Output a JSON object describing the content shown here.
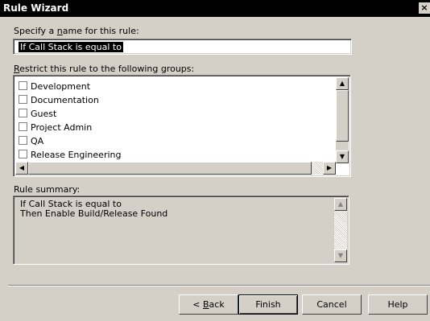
{
  "window": {
    "title": "Rule Wizard",
    "close_glyph": "×"
  },
  "name_section": {
    "label_pre": "Specify a ",
    "label_key": "n",
    "label_post": "ame for this rule:",
    "value": "If Call Stack is equal to"
  },
  "groups_section": {
    "label_key": "R",
    "label_post": "estrict this rule to the following groups:",
    "items": [
      {
        "label": "Development",
        "checked": false
      },
      {
        "label": "Documentation",
        "checked": false
      },
      {
        "label": "Guest",
        "checked": false
      },
      {
        "label": "Project Admin",
        "checked": false
      },
      {
        "label": "QA",
        "checked": false
      },
      {
        "label": "Release Engineering",
        "checked": false
      }
    ]
  },
  "summary_section": {
    "label": "Rule summary:",
    "lines": [
      "If Call Stack is equal to",
      "Then Enable Build/Release Found"
    ]
  },
  "buttons": {
    "back_pre": "< ",
    "back_key": "B",
    "back_post": "ack",
    "finish": "Finish",
    "cancel": "Cancel",
    "help": "Help"
  },
  "icons": {
    "scroll_up": "▲",
    "scroll_down": "▼",
    "scroll_left": "◀",
    "scroll_right": "▶"
  }
}
